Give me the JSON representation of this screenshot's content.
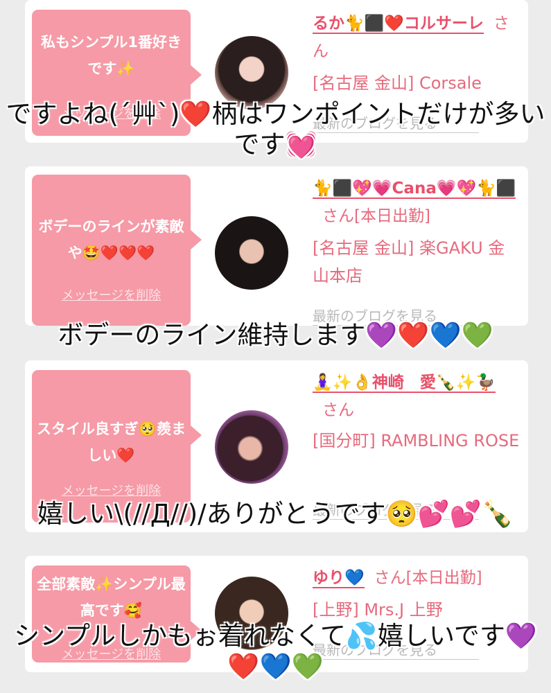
{
  "cards": [
    {
      "message": "私もシンプル1番好きです✨",
      "delete_label": "メッセージを削除",
      "name": "るか🐈⬛❤️コルサーレ",
      "san": "さん",
      "shop": "[名古屋 金山] Corsale",
      "blog_label": "最新のブログを見る",
      "caption": "ですよね(´艸`)❤️柄はワンポイントだけが多いです💓"
    },
    {
      "message": "ボデーのラインが素敵や🤩❤️❤️❤️",
      "delete_label": "メッセージを削除",
      "name": "🐈⬛💖💗Cana💗💖🐈⬛",
      "san": "さん[本日出勤]",
      "shop": "[名古屋 金山] 楽GAKU 金山本店",
      "blog_label": "最新のブログを見る",
      "caption": "ボデーのライン維持します💜❤️💙💚"
    },
    {
      "message": "スタイル良すぎ🥺羨ましい❤️",
      "delete_label": "メッセージを削除",
      "name": "🧘‍♀️✨👌神崎　愛🍾✨🦆",
      "san": "さん",
      "shop": "[国分町] RAMBLING ROSE",
      "blog_label": "最新のブログを見る",
      "caption": "嬉しい\\(//Д//)/ありがとうです🥺💕💕🍾"
    },
    {
      "message": "全部素敵✨シンプル最高です🥰",
      "delete_label": "メッセージを削除",
      "name": "ゆり💙",
      "san": "さん[本日出勤]",
      "shop": "[上野] Mrs.J 上野",
      "blog_label": "最新のブログを見る",
      "caption": "シンプルしかもぉ着れなくて💦嬉しいです💜❤️💙💚"
    }
  ],
  "colors": {
    "accent": "#e8506a",
    "bubble": "#f59aa6"
  }
}
